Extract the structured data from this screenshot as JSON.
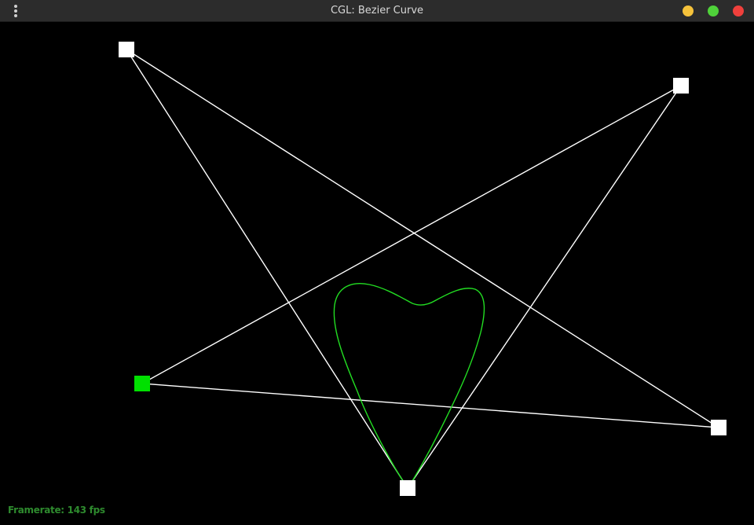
{
  "window": {
    "title": "CGL: Bezier Curve"
  },
  "status": {
    "framerate": "Framerate: 143 fps"
  },
  "colors": {
    "titlebar": "#2c2c2c",
    "control_polygon": "#ffffff",
    "control_point": "#ffffff",
    "selected_control_point": "#00e000",
    "curve": "#22dd22",
    "framerate_text": "#2e8b2e",
    "minimize_button": "#f5c23b",
    "maximize_button": "#4fd23a",
    "close_button": "#f0403c"
  },
  "icons": {
    "menu": "vertical-dots-icon"
  }
}
